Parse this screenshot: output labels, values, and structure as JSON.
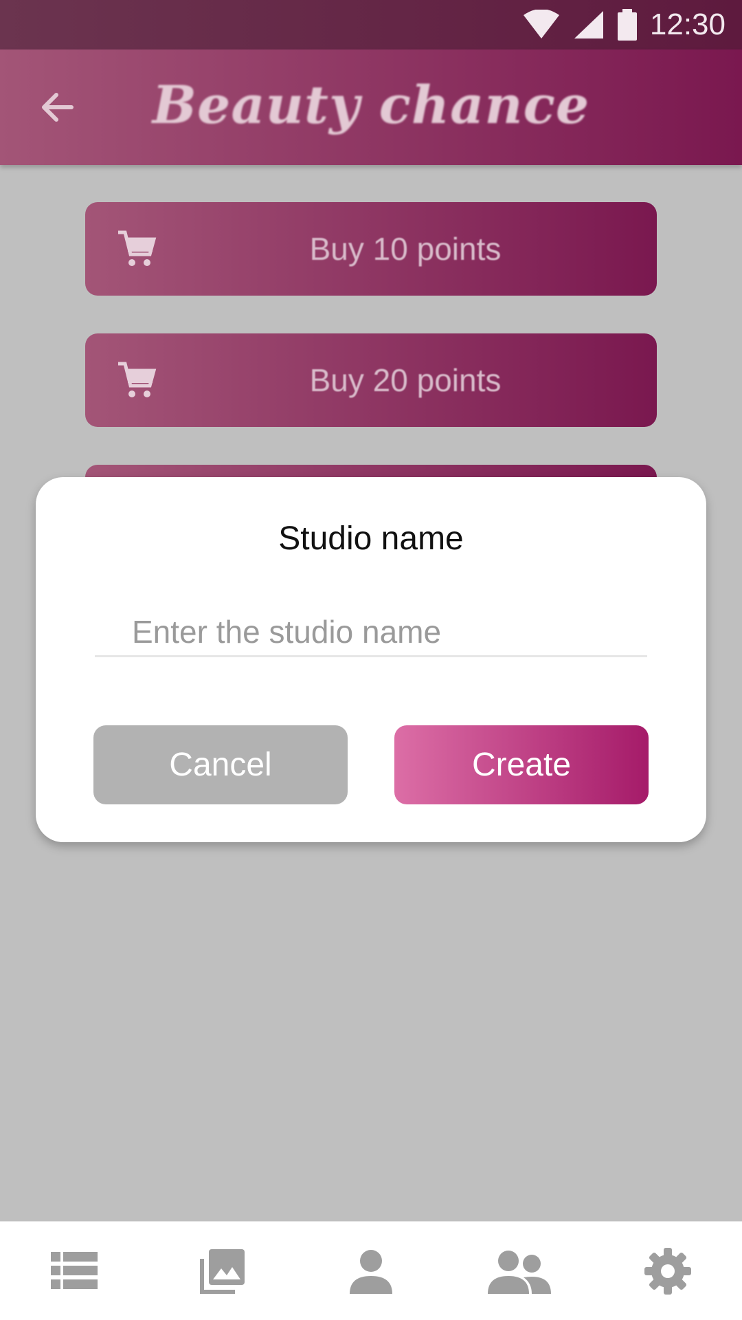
{
  "status_bar": {
    "time": "12:30",
    "icons": [
      "wifi-icon",
      "signal-icon",
      "battery-icon"
    ]
  },
  "app_bar": {
    "title": "Beauty chance",
    "back_icon": "arrow-back-icon"
  },
  "buy_buttons": [
    {
      "label": "Buy 10 points",
      "icon": "cart-icon"
    },
    {
      "label": "Buy 20 points",
      "icon": "cart-icon"
    },
    {
      "label": "",
      "icon": "cart-icon"
    }
  ],
  "dialog": {
    "title": "Studio name",
    "input": {
      "value": "",
      "placeholder": "Enter the studio name"
    },
    "cancel_label": "Cancel",
    "create_label": "Create"
  },
  "bottom_nav": [
    {
      "icon": "list-icon"
    },
    {
      "icon": "photo-library-icon"
    },
    {
      "icon": "person-icon"
    },
    {
      "icon": "people-icon"
    },
    {
      "icon": "settings-icon"
    }
  ],
  "colors": {
    "brand_start": "#dc6ea6",
    "brand_end": "#a51b69",
    "scrim_background": "#bfbfbf",
    "cancel_gray": "#b2b2b2",
    "nav_icon_gray": "#9e9e9e"
  }
}
